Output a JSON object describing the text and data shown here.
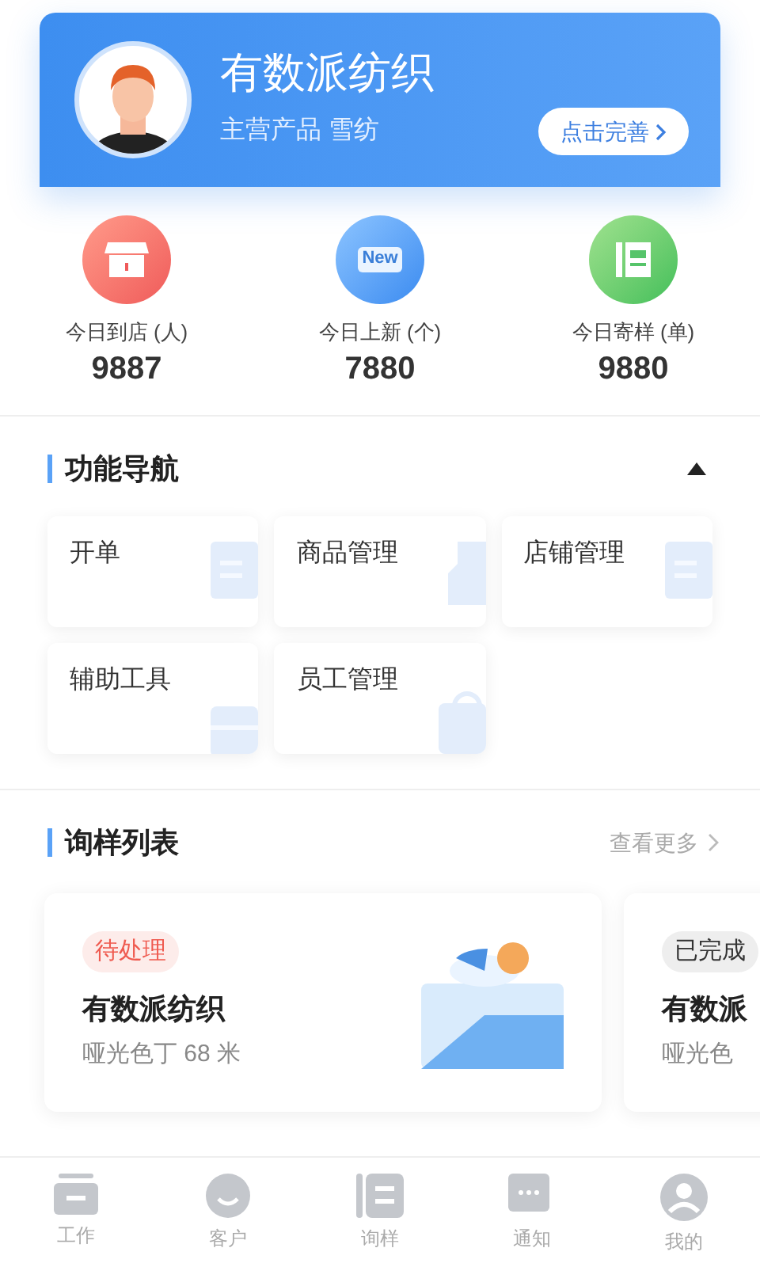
{
  "profile": {
    "name": "有数派纺织",
    "subtitle": "主营产品 雪纺",
    "action": "点击完善"
  },
  "stats": [
    {
      "kind": "store",
      "label": "今日到店 (人)",
      "value": "9887"
    },
    {
      "kind": "new",
      "badge_text": "New",
      "label": "今日上新 (个)",
      "value": "7880"
    },
    {
      "kind": "catalog",
      "label": "今日寄样 (单)",
      "value": "9880"
    }
  ],
  "nav_section": {
    "title": "功能导航",
    "expanded": true,
    "items": [
      {
        "label": "开单",
        "kind": "doc"
      },
      {
        "label": "商品管理",
        "kind": "goods"
      },
      {
        "label": "店铺管理",
        "kind": "doc"
      },
      {
        "label": "辅助工具",
        "kind": "tool"
      },
      {
        "label": "员工管理",
        "kind": "bag"
      }
    ]
  },
  "sample_section": {
    "title": "询样列表",
    "more": "查看更多",
    "cards": [
      {
        "status": {
          "kind": "pending",
          "label": "待处理"
        },
        "title": "有数派纺织",
        "detail": "哑光色丁 68 米"
      },
      {
        "status": {
          "kind": "done",
          "label": "已完成"
        },
        "title": "有数派",
        "detail": "哑光色"
      }
    ]
  },
  "tab_bar": [
    {
      "kind": "work",
      "label": "工作"
    },
    {
      "kind": "customer",
      "label": "客户"
    },
    {
      "kind": "sample",
      "label": "询样"
    },
    {
      "kind": "notice",
      "label": "通知"
    },
    {
      "kind": "mine",
      "label": "我的"
    }
  ]
}
